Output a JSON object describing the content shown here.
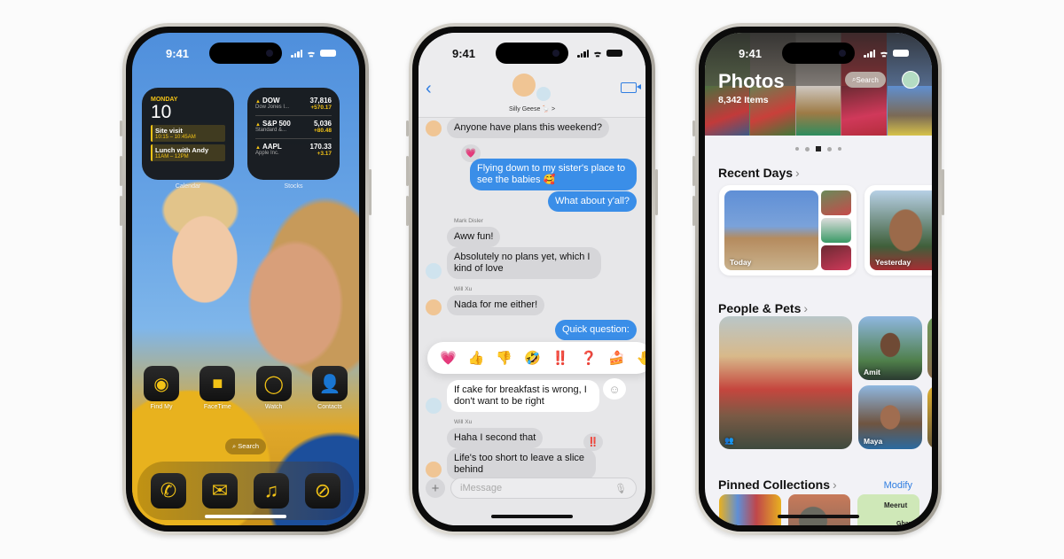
{
  "status": {
    "time": "9:41"
  },
  "home": {
    "calendar": {
      "day": "MONDAY",
      "date": "10",
      "events": [
        {
          "title": "Site visit",
          "time": "10:15 – 10:45AM"
        },
        {
          "title": "Lunch with Andy",
          "time": "11AM – 12PM"
        }
      ],
      "label": "Calendar"
    },
    "stocks": {
      "items": [
        {
          "symbol": "DOW",
          "name": "Dow Jones I...",
          "price": "37,816",
          "change": "+570.17"
        },
        {
          "symbol": "S&P 500",
          "name": "Standard &...",
          "price": "5,036",
          "change": "+80.48"
        },
        {
          "symbol": "AAPL",
          "name": "Apple Inc.",
          "price": "170.33",
          "change": "+3.17"
        }
      ],
      "label": "Stocks"
    },
    "apps": [
      {
        "label": "Find My",
        "icon": "find-my-icon",
        "glyph": "◉"
      },
      {
        "label": "FaceTime",
        "icon": "facetime-icon",
        "glyph": "■"
      },
      {
        "label": "Watch",
        "icon": "watch-icon",
        "glyph": "◯"
      },
      {
        "label": "Contacts",
        "icon": "contacts-icon",
        "glyph": "👤"
      }
    ],
    "search_label": "Search",
    "dock": [
      {
        "icon": "phone-icon",
        "glyph": "✆"
      },
      {
        "icon": "mail-icon",
        "glyph": "✉"
      },
      {
        "icon": "music-icon",
        "glyph": "♫"
      },
      {
        "icon": "safari-icon",
        "glyph": "⊘"
      }
    ]
  },
  "messages": {
    "group_name": "Silly Geese 🪿 >",
    "thread": [
      {
        "text": "Anyone have plans this weekend?"
      },
      {
        "text": "Flying down to my sister's place to see the babies 🥰"
      },
      {
        "text": "What about y'all?"
      },
      {
        "sender": "Mark Disler"
      },
      {
        "text": "Aww fun!"
      },
      {
        "text": "Absolutely no plans yet, which I kind of love"
      },
      {
        "sender": "Will Xu"
      },
      {
        "text": "Nada for me either!"
      },
      {
        "text": "Quick question:"
      },
      {
        "text": "If cake for breakfast is wrong, I don't want to be right"
      },
      {
        "sender": "Will Xu"
      },
      {
        "text": "Haha I second that"
      },
      {
        "text": "Life's too short to leave a slice behind"
      }
    ],
    "tapbacks": [
      "💗",
      "👍",
      "👎",
      "🤣",
      "‼️",
      "❓",
      "🍰",
      "🤚"
    ],
    "reactions": {
      "heart": "💗",
      "exclaim": "‼️"
    },
    "composer_placeholder": "iMessage"
  },
  "photos": {
    "title": "Photos",
    "count": "8,342 Items",
    "search_label": "Search",
    "sections": {
      "recent": "Recent Days",
      "people": "People & Pets",
      "pinned": "Pinned Collections",
      "modify": "Modify"
    },
    "recent_cards": [
      "Today",
      "Yesterday"
    ],
    "people": [
      "Amit",
      "Maya"
    ],
    "map_labels": [
      "Meerut",
      "Ghaz"
    ]
  }
}
